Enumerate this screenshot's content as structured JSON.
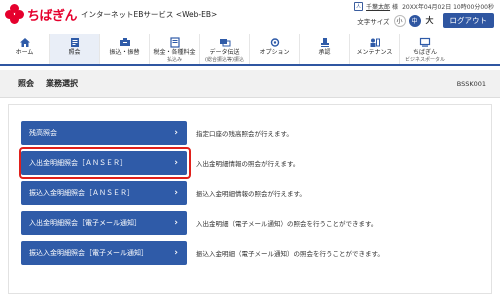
{
  "header": {
    "brand": "ちばぎん",
    "service": "インターネットEBサービス <Web-EB>",
    "user_name": "千葉太郎",
    "user_honorific": "様",
    "last_login": "20XX年04月02日 10時00分00秒",
    "font_size_label": "文字サイズ",
    "font_small": "小",
    "font_mid": "中",
    "font_large": "大",
    "logout": "ログアウト"
  },
  "nav": [
    {
      "label": "ホーム",
      "sub": "",
      "icon": "home-icon"
    },
    {
      "label": "照会",
      "sub": "",
      "icon": "inquiry-icon"
    },
    {
      "label": "振込・振替",
      "sub": "",
      "icon": "transfer-icon"
    },
    {
      "label": "税金・各種料金",
      "sub": "払込み",
      "icon": "tax-payment-icon"
    },
    {
      "label": "データ伝送",
      "sub": "(総合振込等)振込",
      "icon": "data-transfer-icon"
    },
    {
      "label": "オプション",
      "sub": "",
      "icon": "option-icon"
    },
    {
      "label": "承認",
      "sub": "",
      "icon": "approval-icon"
    },
    {
      "label": "メンテナンス",
      "sub": "",
      "icon": "maintenance-icon"
    },
    {
      "label": "ちばぎん",
      "sub": "ビジネスポータル",
      "icon": "portal-icon"
    }
  ],
  "active_nav": "照会",
  "titlebar": {
    "title": "照会",
    "subtitle": "業務選択",
    "screen_id": "BSSK001"
  },
  "menu": [
    {
      "label": "残高照会",
      "desc": "指定口座の残高照会が行えます。"
    },
    {
      "label": "入出金明細照会［ＡＮＳＥＲ］",
      "desc": "入出金明細情報の照会が行えます。"
    },
    {
      "label": "振込入金明細照会［ＡＮＳＥＲ］",
      "desc": "振込入金明細情報の照会が行えます。"
    },
    {
      "label": "入出金明細照会［電子メール通知］",
      "desc": "入出金明細（電子メール通知）の照会を行うことができます。"
    },
    {
      "label": "振込入金明細照会［電子メール通知］",
      "desc": "振込入金明細（電子メール通知）の照会を行うことができます。"
    }
  ],
  "colors": {
    "brand_red": "#e5002d",
    "primary_blue": "#2f5ba8",
    "highlight_red": "#e0201b"
  }
}
